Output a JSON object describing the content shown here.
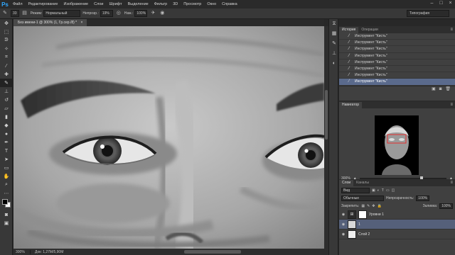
{
  "app": {
    "logo": "Ps"
  },
  "menu": [
    "Файл",
    "Редактирование",
    "Изображение",
    "Слои",
    "Шрифт",
    "Выделение",
    "Фильтр",
    "3D",
    "Просмотр",
    "Окно",
    "Справка"
  ],
  "window_controls": [
    "–",
    "□",
    "×"
  ],
  "options": {
    "brush_size": "33",
    "mode_label": "Режим:",
    "mode_value": "Нормальный",
    "opacity_label": "Непрозр.:",
    "opacity_value": "19%",
    "flow_label": "Наж.:",
    "flow_value": "100%",
    "workspace": "Типография"
  },
  "document": {
    "tab_title": "Без имени-1 @ 300% (1, Гр.сер./8) *",
    "tab_close": "×"
  },
  "status": {
    "zoom": "300%",
    "doc_size": "Док: 1,27М/5,90М"
  },
  "history": {
    "tabs": [
      "История",
      "Операции"
    ],
    "items": [
      "Инструмент \"Кисть\"",
      "Инструмент \"Кисть\"",
      "Инструмент \"Кисть\"",
      "Инструмент \"Кисть\"",
      "Инструмент \"Кисть\"",
      "Инструмент \"Кисть\"",
      "Инструмент \"Кисть\"",
      "Инструмент \"Кисть\""
    ],
    "active_index": 7
  },
  "navigator": {
    "tab": "Навигатор",
    "zoom": "300%"
  },
  "layers": {
    "tabs": [
      "Слои",
      "Каналы"
    ],
    "filter": "Вид",
    "blend_mode": "Обычные",
    "opacity_label": "Непрозрачность:",
    "opacity_value": "100%",
    "lock_label": "Закрепить:",
    "fill_label": "Заливка:",
    "fill_value": "100%",
    "items": [
      {
        "name": "Уровни 1"
      },
      {
        "name": "1"
      },
      {
        "name": "Слой 2"
      }
    ]
  },
  "colors": {
    "accent": "#31a8ff",
    "selection": "#5a6a8c"
  }
}
